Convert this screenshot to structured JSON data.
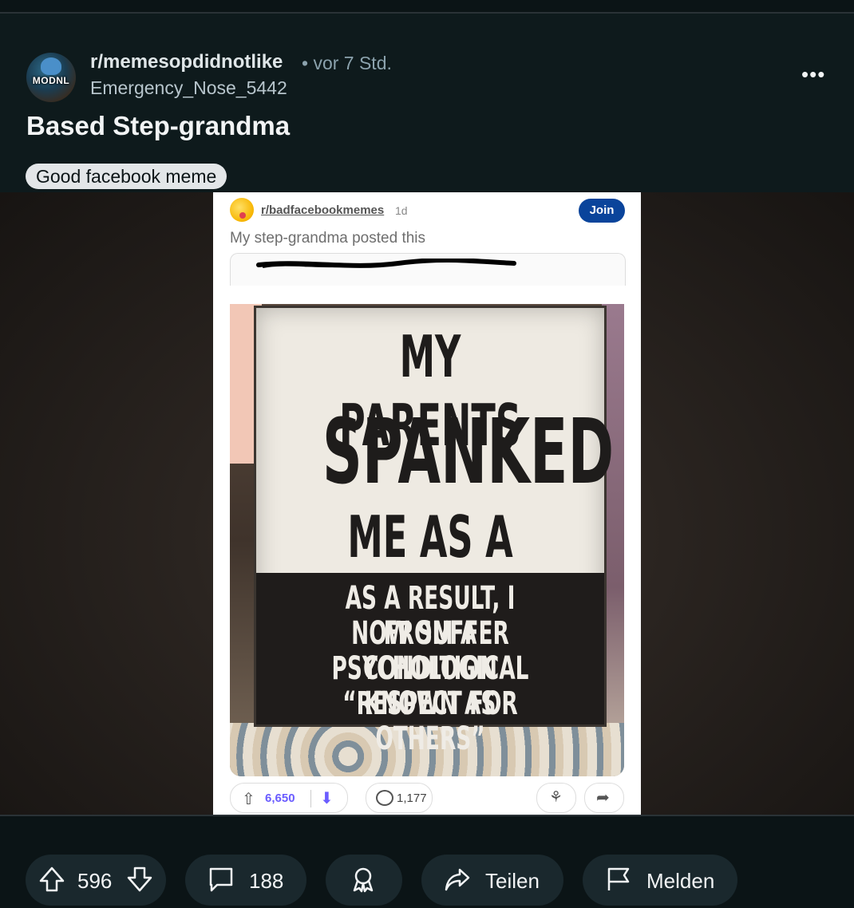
{
  "post": {
    "subreddit": "r/memesopdidnotlike",
    "time": "• vor 7 Std.",
    "author": "Emergency_Nose_5442",
    "title": "Based Step-grandma",
    "flair": "Good facebook meme",
    "more_icon": "•••",
    "avatar_text": "MODNL"
  },
  "embedded": {
    "subreddit": "r/badfacebookmemes",
    "age": "1d",
    "join": "Join",
    "caption": "My step-grandma posted this",
    "votes": "6,650",
    "comments": "1,177",
    "vote_color": "#6a5cff",
    "join_color": "#0a449b"
  },
  "sign": {
    "line1": "MY PARENTS",
    "line2": "SPANKED",
    "line3": "ME AS A CHILD",
    "bottom1": "AS A RESULT, I NOW SUFFER",
    "bottom2": "FROM A PSYCHOLOGICAL",
    "bottom3": "CONDITION KNOWN AS",
    "bottom4": "“RESPECT FOR OTHERS”"
  },
  "actions": {
    "votes": "596",
    "comments": "188",
    "share": "Teilen",
    "report": "Melden",
    "icons": [
      "upvote-icon",
      "downvote-icon",
      "comment-icon",
      "award-icon",
      "share-icon",
      "flag-icon"
    ]
  }
}
